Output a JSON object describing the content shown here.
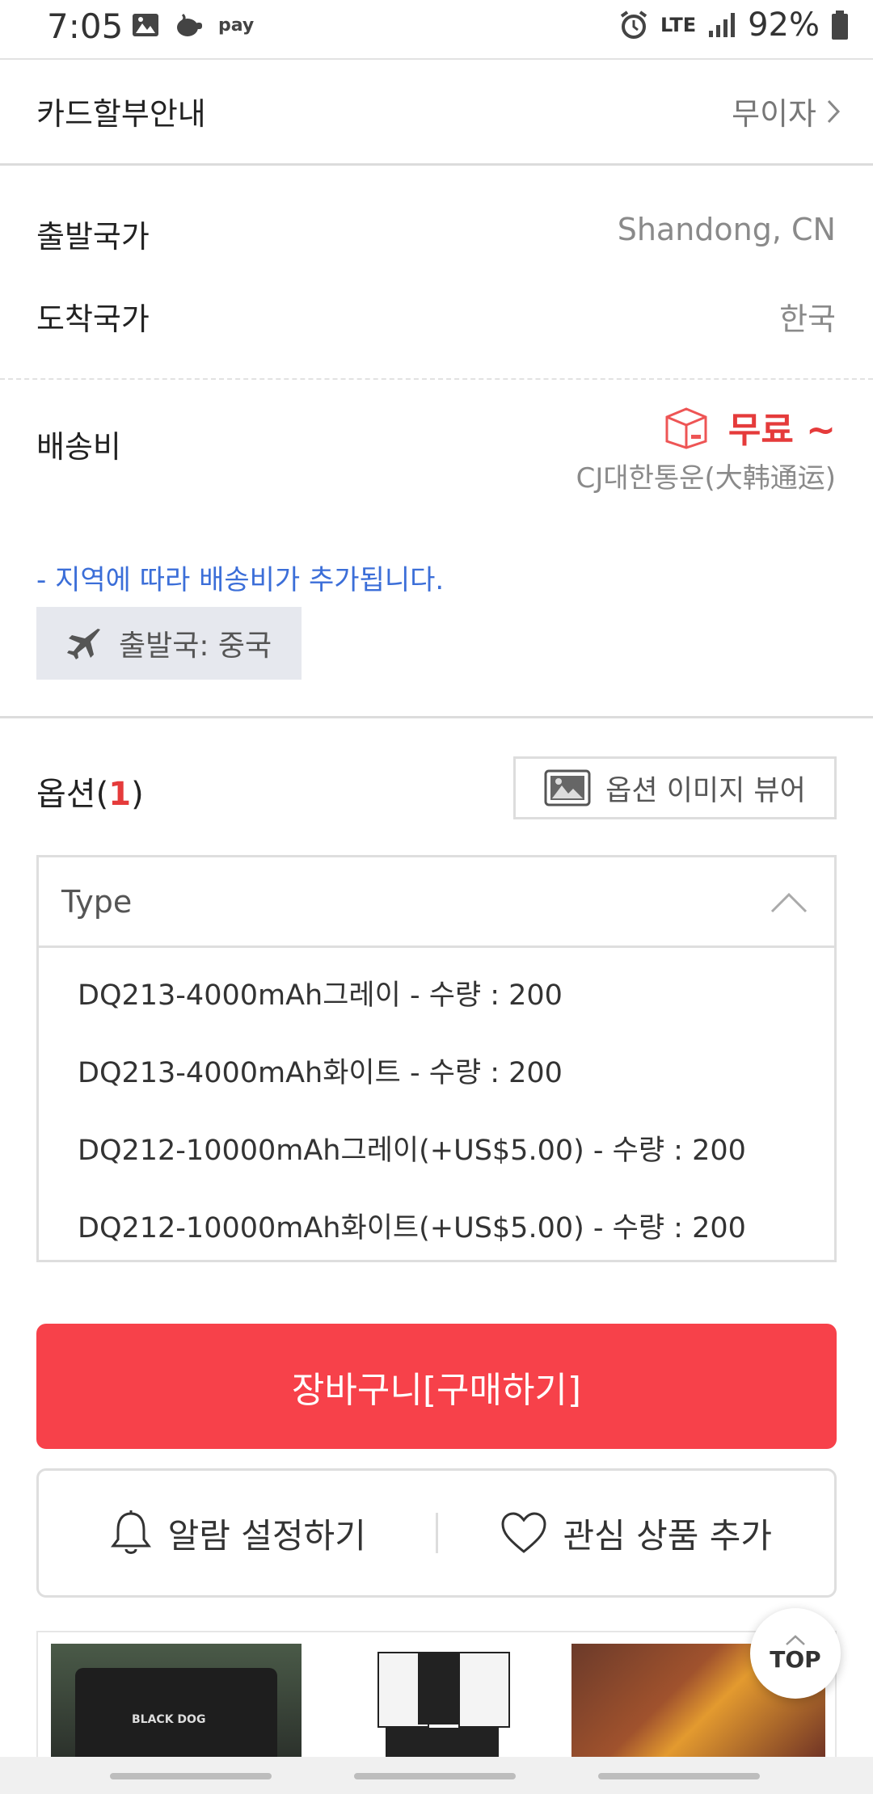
{
  "status_bar": {
    "time": "7:05",
    "network": "LTE",
    "battery": "92%",
    "pay_label": "pay"
  },
  "installment": {
    "label": "카드할부안내",
    "value": "무이자"
  },
  "shipping_info": {
    "origin_label": "출발국가",
    "origin_value": "Shandong, CN",
    "dest_label": "도착국가",
    "dest_value": "한국"
  },
  "delivery": {
    "label": "배송비",
    "fee": "무료 ~",
    "carrier": "CJ대한통운(大韩通运)",
    "note": "- 지역에 따라 배송비가 추가됩니다.",
    "departure_tag": "출발국: 중국"
  },
  "options": {
    "title": "옵션(",
    "count": "1",
    "title_end": ")",
    "viewer_button": "옵션 이미지 뷰어",
    "select_label": "Type",
    "items": [
      "DQ213-4000mAh그레이 - 수량 : 200",
      "DQ213-4000mAh화이트 - 수량 : 200",
      "DQ212-10000mAh그레이(+US$5.00) - 수량 : 200",
      "DQ212-10000mAh화이트(+US$5.00) - 수량 : 200"
    ]
  },
  "actions": {
    "cart_button": "장바구니[구매하기]",
    "alarm_button": "알람 설정하기",
    "wishlist_button": "관심 상품 추가",
    "top_button": "TOP"
  },
  "thumbnails": {
    "bag_text": "BLACK DOG"
  },
  "colors": {
    "accent_red": "#f7414a",
    "price_red": "#e53b3b",
    "note_blue": "#3b6ed8"
  }
}
